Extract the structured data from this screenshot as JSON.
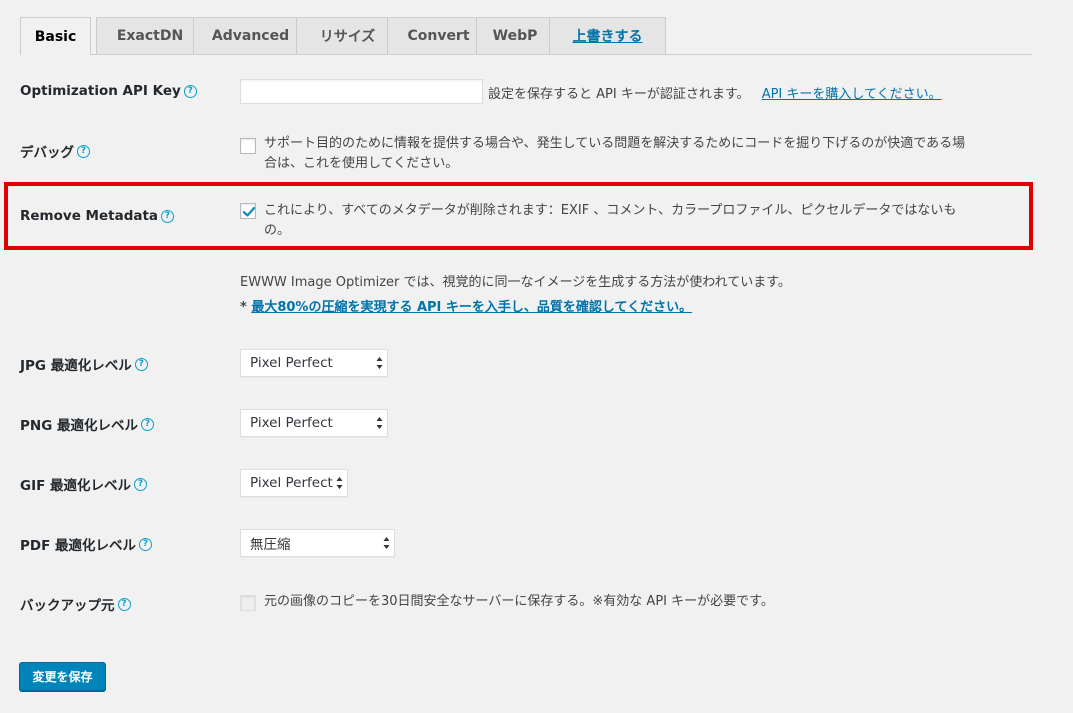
{
  "tabs": [
    {
      "label": "Basic"
    },
    {
      "label": "ExactDN"
    },
    {
      "label": "Advanced"
    },
    {
      "label": "リサイズ"
    },
    {
      "label": "Convert"
    },
    {
      "label": "WebP"
    },
    {
      "label": "上書きする"
    }
  ],
  "help_glyph": "?",
  "api_key": {
    "label": "Optimization API Key",
    "value": "",
    "note": "設定を保存すると API キーが認証されます。",
    "link": "API キーを購入してください。"
  },
  "debug": {
    "label": "デバッグ",
    "checked": false,
    "text_line1": "サポート目的のために情報を提供する場合や、発生している問題を解決するためにコードを掘り下げるのが快適である場",
    "text_line2": "合は、これを使用してください。"
  },
  "metadata": {
    "label": "Remove Metadata",
    "checked": true,
    "text_line1": "これにより、すべてのメタデータが削除されます：EXIF 、コメント、カラープロファイル、ピクセルデータではないも",
    "text_line2": "の。"
  },
  "info": {
    "line1": "EWWW Image Optimizer では、視覚的に同一なイメージを生成する方法が使われています。",
    "prefix": "* ",
    "link": "最大80%の圧縮を実現する API キーを入手し、品質を確認してください。"
  },
  "jpg": {
    "label": "JPG 最適化レベル",
    "selected": "Pixel Perfect"
  },
  "png": {
    "label": "PNG 最適化レベル",
    "selected": "Pixel Perfect"
  },
  "gif": {
    "label": "GIF 最適化レベル",
    "selected": "Pixel Perfect"
  },
  "pdf": {
    "label": "PDF 最適化レベル",
    "selected": "無圧縮"
  },
  "backup": {
    "label": "バックアップ元",
    "checked": false,
    "text": "元の画像のコピーを30日間安全なサーバーに保存する。※有効な API キーが必要です。"
  },
  "save_button": "変更を保存",
  "colors": {
    "accent": "#0085ba",
    "link": "#0073aa",
    "help": "#0aa0c8",
    "highlight": "#e00000"
  }
}
